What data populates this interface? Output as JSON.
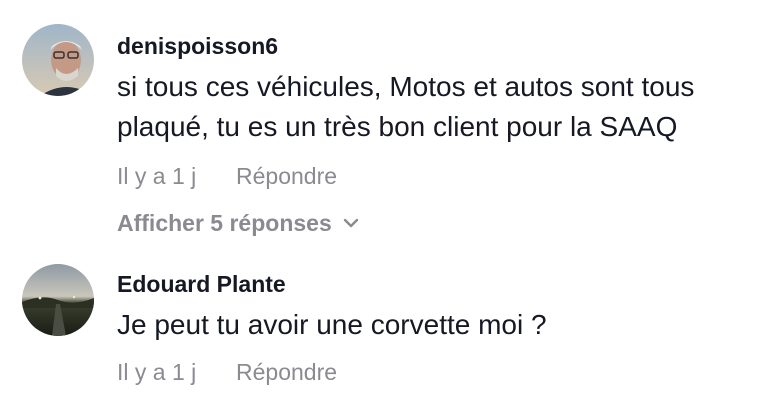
{
  "comments": [
    {
      "username": "denispoisson6",
      "text_line1": "si tous ces véhicules, Motos et autos sont tous",
      "text_line2": "plaqué, tu es un très bon client pour la SAAQ",
      "time": "Il y a 1 j",
      "reply_label": "Répondre",
      "replies_label": "Afficher 5 réponses",
      "avatar_icon": "profile-photo-man-glasses"
    },
    {
      "username": "Edouard Plante",
      "text_line1": "Je peut tu avoir une corvette moi ?",
      "time": "Il y a 1 j",
      "reply_label": "Répondre",
      "avatar_icon": "profile-photo-road-dusk"
    }
  ],
  "colors": {
    "text": "#161823",
    "muted": "#8a8b91"
  }
}
